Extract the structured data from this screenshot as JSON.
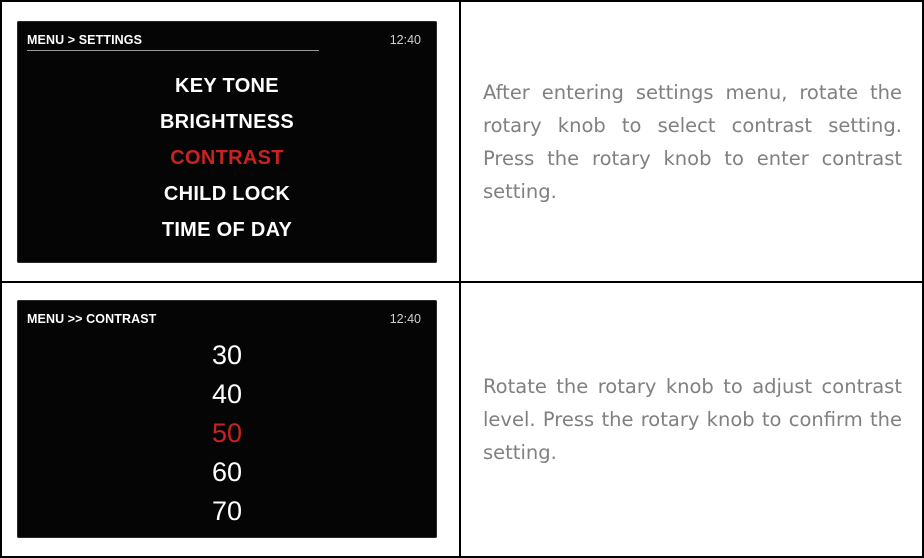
{
  "rows": [
    {
      "screen": {
        "breadcrumb": "MENU > SETTINGS",
        "clock": "12:40",
        "items": [
          "KEY TONE",
          "BRIGHTNESS",
          "CONTRAST",
          "CHILD LOCK",
          "TIME OF DAY"
        ],
        "selected_item": "CONTRAST"
      },
      "description": "After entering settings menu, rotate the rotary knob to select contrast setting. Press the rotary knob to enter contrast setting."
    },
    {
      "screen": {
        "breadcrumb": "MENU >> CONTRAST",
        "clock": "12:40",
        "values": [
          "30",
          "40",
          "50",
          "60",
          "70"
        ],
        "selected_value": "50"
      },
      "description": "Rotate the rotary knob to adjust contrast level. Press the rotary knob to confirm the setting."
    }
  ],
  "colors": {
    "screen_background": "#050505",
    "selected_text": "#c8231e",
    "normal_text": "#ffffff",
    "description_text": "#808080"
  }
}
